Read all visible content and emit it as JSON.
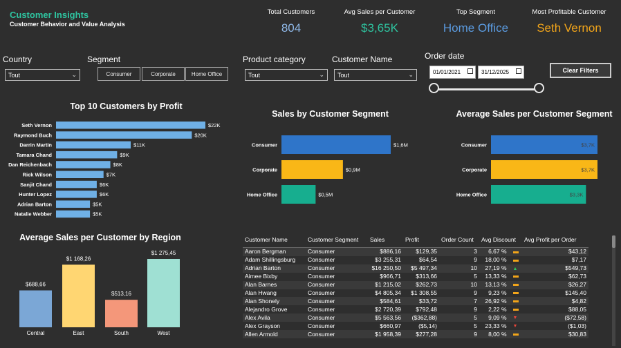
{
  "header": {
    "title": "Customer Insights",
    "subtitle": "Customer Behavior and Value Analysis"
  },
  "kpis": [
    {
      "label": "Total Customers",
      "value": "804",
      "color": "#8fb8e8"
    },
    {
      "label": "Avg Sales per Customer",
      "value": "$3,65K",
      "color": "#2ec4a0"
    },
    {
      "label": "Top Segment",
      "value": "Home Office",
      "color": "#5b9be0"
    },
    {
      "label": "Most Profitable Customer",
      "value": "Seth Vernon",
      "color": "#f2a51a"
    }
  ],
  "filters": {
    "country_label": "Country",
    "country_value": "Tout",
    "segment_label": "Segment",
    "segment_options": [
      "Consumer",
      "Corporate",
      "Home Office"
    ],
    "product_label": "Product category",
    "product_value": "Tout",
    "customer_label": "Customer Name",
    "customer_value": "Tout",
    "date_label": "Order date",
    "date_start": "01/01/2021",
    "date_end": "31/12/2025",
    "clear_label": "Clear Filters"
  },
  "chart_data": [
    {
      "type": "bar",
      "orientation": "horizontal",
      "title": "Top 10 Customers by Profit",
      "categories": [
        "Seth Vernon",
        "Raymond Buch",
        "Darrin Martin",
        "Tamara Chand",
        "Dan Reichenbach",
        "Rick Wilson",
        "Sanjit Chand",
        "Hunter Lopez",
        "Adrian Barton",
        "Natalie Webber"
      ],
      "values": [
        22,
        20,
        11,
        9,
        8,
        7,
        6,
        6,
        5,
        5
      ],
      "labels": [
        "$22K",
        "$20K",
        "$11K",
        "$9K",
        "$8K",
        "$7K",
        "$6K",
        "$6K",
        "$5K",
        "$5K"
      ],
      "xlim": [
        0,
        22
      ],
      "color": "#6fb0e6"
    },
    {
      "type": "bar",
      "orientation": "horizontal",
      "title": "Sales by Customer Segment",
      "categories": [
        "Consumer",
        "Corporate",
        "Home Office"
      ],
      "values": [
        1.6,
        0.9,
        0.5
      ],
      "labels": [
        "$1,6M",
        "$0,9M",
        "$0,5M"
      ],
      "colors": [
        "#2f75c9",
        "#f9b717",
        "#17ae8f"
      ],
      "xlim": [
        0,
        1.6
      ]
    },
    {
      "type": "bar",
      "orientation": "horizontal",
      "title": "Average Sales per Customer Segment",
      "categories": [
        "Consumer",
        "Corporate",
        "Home Office"
      ],
      "values": [
        3.7,
        3.7,
        3.3
      ],
      "labels": [
        "$3,7K",
        "$3,7K",
        "$3,3K"
      ],
      "colors": [
        "#2f75c9",
        "#f9b717",
        "#17ae8f"
      ],
      "xlim": [
        0,
        3.7
      ]
    },
    {
      "type": "bar",
      "orientation": "vertical",
      "title": "Average Sales per Customer by Region",
      "categories": [
        "Central",
        "East",
        "South",
        "West"
      ],
      "values": [
        688.66,
        1168.26,
        513.16,
        1275.45
      ],
      "labels": [
        "$688,66",
        "$1 168,26",
        "$513,16",
        "$1 275,45"
      ],
      "colors": [
        "#7ba7d6",
        "#ffd672",
        "#f4977a",
        "#9fe0d3"
      ],
      "ylim": [
        0,
        1275.45
      ]
    }
  ],
  "table": {
    "columns": [
      "Customer Name",
      "Customer Segment",
      "Sales",
      "Profit",
      "Order Count",
      "Avg Discount",
      "Avg Profit per Order"
    ],
    "rows": [
      [
        "Aaron Bergman",
        "Consumer",
        "$886,16",
        "$129,35",
        "3",
        "6,67 %",
        "flat",
        "$43,12"
      ],
      [
        "Adam Shillingsburg",
        "Consumer",
        "$3 255,31",
        "$64,54",
        "9",
        "18,00 %",
        "flat",
        "$7,17"
      ],
      [
        "Adrian Barton",
        "Consumer",
        "$16 250,50",
        "$5 497,34",
        "10",
        "27,19 %",
        "up",
        "$549,73"
      ],
      [
        "Aimee Bixby",
        "Consumer",
        "$966,71",
        "$313,66",
        "5",
        "13,33 %",
        "flat",
        "$62,73"
      ],
      [
        "Alan Barnes",
        "Consumer",
        "$1 215,02",
        "$262,73",
        "10",
        "13,13 %",
        "flat",
        "$26,27"
      ],
      [
        "Alan Hwang",
        "Consumer",
        "$4 805,34",
        "$1 308,55",
        "9",
        "9,23 %",
        "flat",
        "$145,40"
      ],
      [
        "Alan Shonely",
        "Consumer",
        "$584,61",
        "$33,72",
        "7",
        "26,92 %",
        "flat",
        "$4,82"
      ],
      [
        "Alejandro Grove",
        "Consumer",
        "$2 720,39",
        "$792,48",
        "9",
        "2,22 %",
        "flat",
        "$88,05"
      ],
      [
        "Alex Avila",
        "Consumer",
        "$5 563,56",
        "($362,88)",
        "5",
        "9,09 %",
        "down",
        "($72,58)"
      ],
      [
        "Alex Grayson",
        "Consumer",
        "$660,97",
        "($5,14)",
        "5",
        "23,33 %",
        "down",
        "($1,03)"
      ],
      [
        "Allen Armold",
        "Consumer",
        "$1 958,39",
        "$277,28",
        "9",
        "8,00 %",
        "flat",
        "$30,83"
      ]
    ]
  },
  "colors": {
    "trend_up": "#2ec45a",
    "trend_down": "#e8463b",
    "trend_flat": "#f2a51a"
  }
}
